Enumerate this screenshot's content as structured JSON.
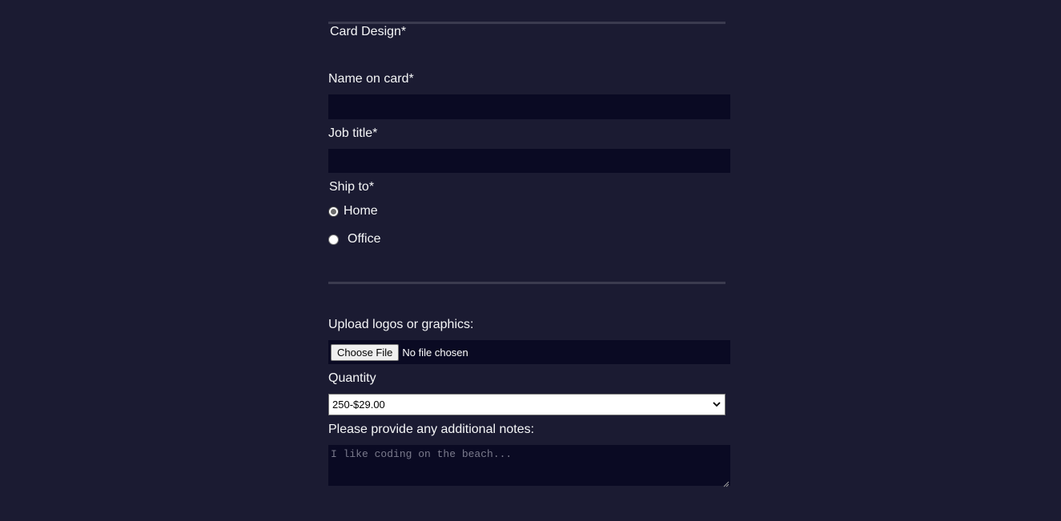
{
  "form": {
    "card_design_label": "Card Design*",
    "name_label": "Name on card*",
    "name_value": "",
    "job_label": "Job title*",
    "job_value": "",
    "ship_label": "Ship to*",
    "ship_options": [
      {
        "label": "Home",
        "checked": true
      },
      {
        "label": "Office",
        "checked": false
      }
    ],
    "upload_label": "Upload logos or graphics:",
    "upload_button": "Choose File",
    "upload_status": "No file chosen",
    "quantity_label": "Quantity",
    "quantity_selected": "250-$29.00",
    "notes_label": "Please provide any additional notes:",
    "notes_placeholder": "I like coding on the beach..."
  },
  "colors": {
    "background": "#1b1b32",
    "input_background": "#0a0a23",
    "divider": "#3b3b4f",
    "text": "#f5f6f7"
  }
}
